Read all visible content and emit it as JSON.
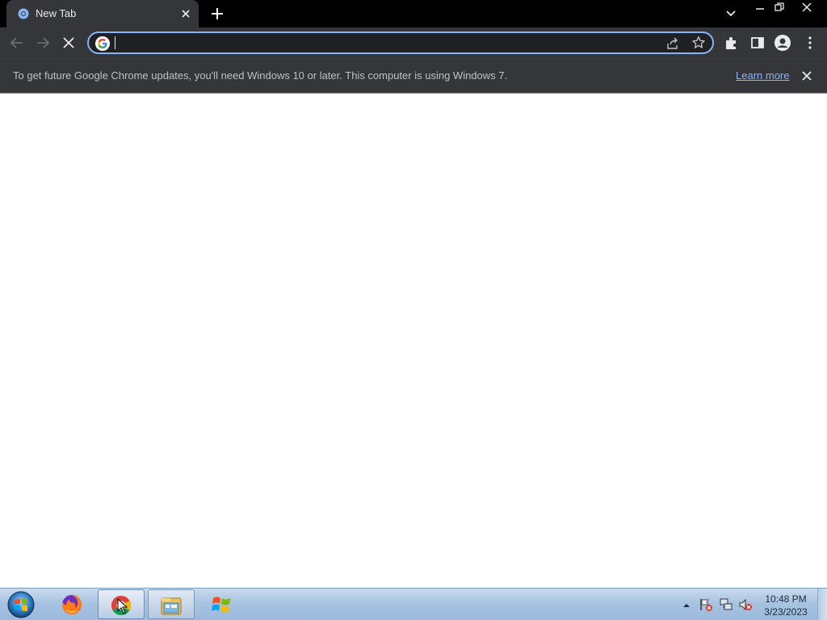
{
  "browser": {
    "tab": {
      "title": "New Tab",
      "favicon": "chrome-favicon-icon"
    },
    "omnibox": {
      "value": "",
      "placeholder": ""
    },
    "colors": {
      "tab_bg": "#35363a",
      "strip_bg": "#000000",
      "accent": "#8ab4f8"
    }
  },
  "infobar": {
    "message": "To get future Google Chrome updates, you'll need Windows 10 or later. This computer is using Windows 7.",
    "link": "Learn more"
  },
  "taskbar": {
    "apps": [
      {
        "name": "Firefox",
        "icon": "firefox-icon",
        "active": false
      },
      {
        "name": "Google Chrome",
        "icon": "chrome-icon",
        "active": true
      },
      {
        "name": "Windows Explorer",
        "icon": "explorer-icon",
        "active": false
      },
      {
        "name": "Windows",
        "icon": "windows-flag-icon",
        "active": false
      }
    ],
    "clock": {
      "time": "10:48 PM",
      "date": "3/23/2023"
    }
  }
}
